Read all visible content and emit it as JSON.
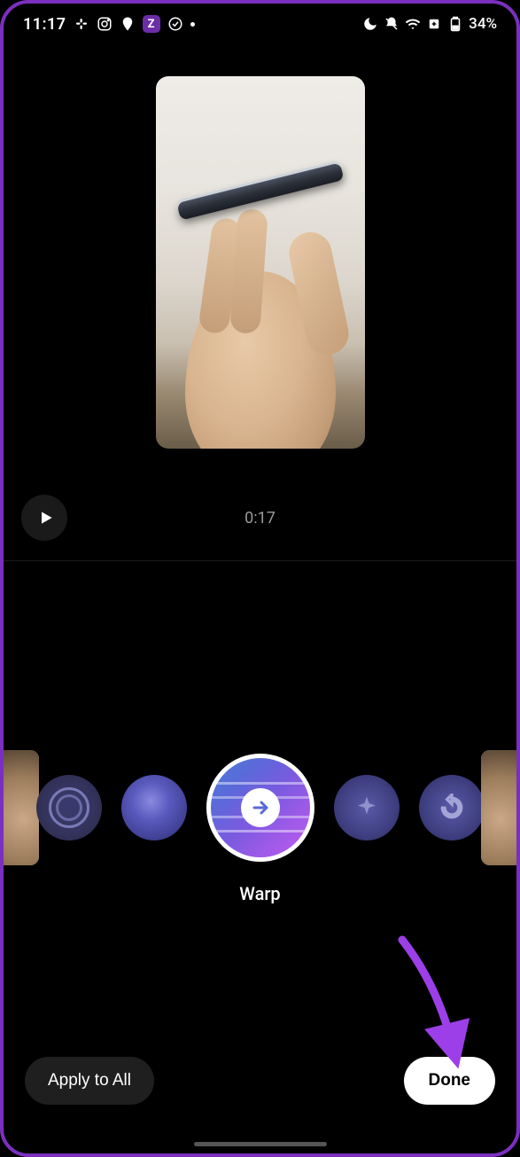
{
  "status": {
    "time": "11:17",
    "battery_text": "34%"
  },
  "preview": {
    "timestamp": "0:17"
  },
  "effects": {
    "items": [
      {
        "id": "rings"
      },
      {
        "id": "glow"
      },
      {
        "id": "warp"
      },
      {
        "id": "sparkle"
      },
      {
        "id": "rewind"
      }
    ],
    "selected_label": "Warp"
  },
  "buttons": {
    "apply_all": "Apply to All",
    "done": "Done"
  }
}
